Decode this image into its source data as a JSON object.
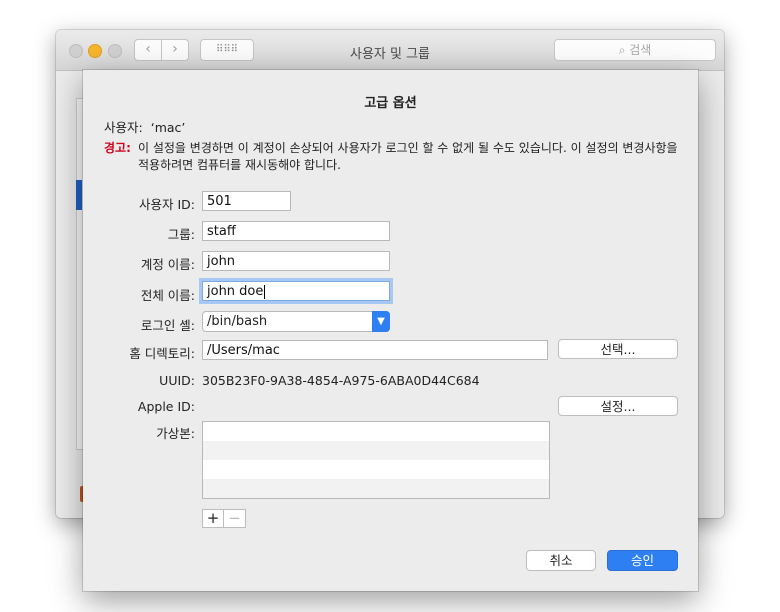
{
  "window": {
    "title": "사용자 및 그룹",
    "search_placeholder": "⌕ 검색",
    "back_icon": "‹",
    "forward_icon": "›",
    "grid_icon": "⠿⠿⠿"
  },
  "sheet": {
    "title": "고급 옵션",
    "user_label": "사용자:",
    "user_value": "‘mac’",
    "warning_label": "경고:",
    "warning_text": "이 설정을 변경하면 이 계정이 손상되어 사용자가 로그인 할 수 없게 될 수도 있습니다. 이 설정의 변경사항을 적용하려면 컴퓨터를 재시동해야 합니다.",
    "fields": {
      "user_id_label": "사용자 ID:",
      "user_id_value": "501",
      "group_label": "그룹:",
      "group_value": "staff",
      "account_name_label": "계정 이름:",
      "account_name_value": "john",
      "full_name_label": "전체 이름:",
      "full_name_value": "john doe",
      "login_shell_label": "로그인 셸:",
      "login_shell_value": "/bin/bash",
      "home_dir_label": "홈 디렉토리:",
      "home_dir_value": "/Users/mac",
      "choose_button": "선택...",
      "uuid_label": "UUID:",
      "uuid_value": "305B23F0-9A38-4854-A975-6ABA0D44C684",
      "apple_id_label": "Apple ID:",
      "apple_id_set_button": "설정...",
      "aliases_label": "가상본:"
    },
    "add_button": "+",
    "remove_button": "−",
    "cancel_button": "취소",
    "ok_button": "승인"
  },
  "colors": {
    "accent": "#2e7ff1",
    "warning": "#d0021b",
    "minimize": "#f7b52c"
  }
}
